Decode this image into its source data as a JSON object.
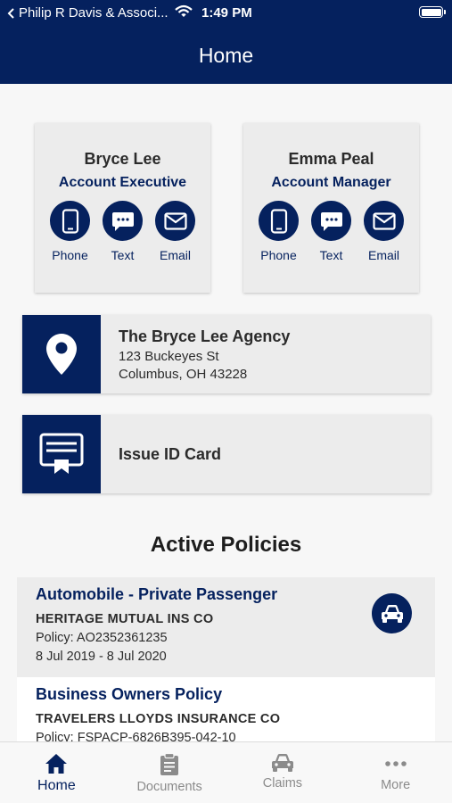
{
  "status_bar": {
    "back_label": "Philip R Davis & Associ...",
    "time": "1:49 PM"
  },
  "nav": {
    "title": "Home"
  },
  "contacts": [
    {
      "name": "Bryce Lee",
      "role": "Account Executive",
      "actions": [
        {
          "label": "Phone",
          "icon": "phone-icon"
        },
        {
          "label": "Text",
          "icon": "text-bubble-icon"
        },
        {
          "label": "Email",
          "icon": "email-icon"
        }
      ]
    },
    {
      "name": "Emma Peal",
      "role": "Account Manager",
      "actions": [
        {
          "label": "Phone",
          "icon": "phone-icon"
        },
        {
          "label": "Text",
          "icon": "text-bubble-icon"
        },
        {
          "label": "Email",
          "icon": "email-icon"
        }
      ]
    }
  ],
  "agency": {
    "name": "The Bryce Lee Agency",
    "address_line1": "123 Buckeyes St",
    "address_line2": "Columbus, OH 43228",
    "icon": "location-pin-icon"
  },
  "id_card": {
    "label": "Issue ID Card",
    "icon": "id-card-icon"
  },
  "policies": {
    "title": "Active Policies",
    "items": [
      {
        "title": "Automobile - Private Passenger",
        "carrier": "HERITAGE MUTUAL INS CO",
        "policy": "Policy: AO2352361235",
        "dates": "8 Jul 2019 - 8 Jul 2020",
        "icon": "car-icon"
      },
      {
        "title": "Business Owners Policy",
        "carrier": "TRAVELERS LLOYDS INSURANCE CO",
        "policy": "Policy: FSPACP-6826B395-042-10"
      }
    ]
  },
  "tabs": [
    {
      "label": "Home",
      "icon": "home-icon",
      "active": true
    },
    {
      "label": "Documents",
      "icon": "clipboard-icon",
      "active": false
    },
    {
      "label": "Claims",
      "icon": "car-icon",
      "active": false
    },
    {
      "label": "More",
      "icon": "more-dots-icon",
      "active": false
    }
  ],
  "colors": {
    "brand": "#05215e",
    "card_bg": "#ececec",
    "inactive_tab": "#8b8b8b"
  }
}
